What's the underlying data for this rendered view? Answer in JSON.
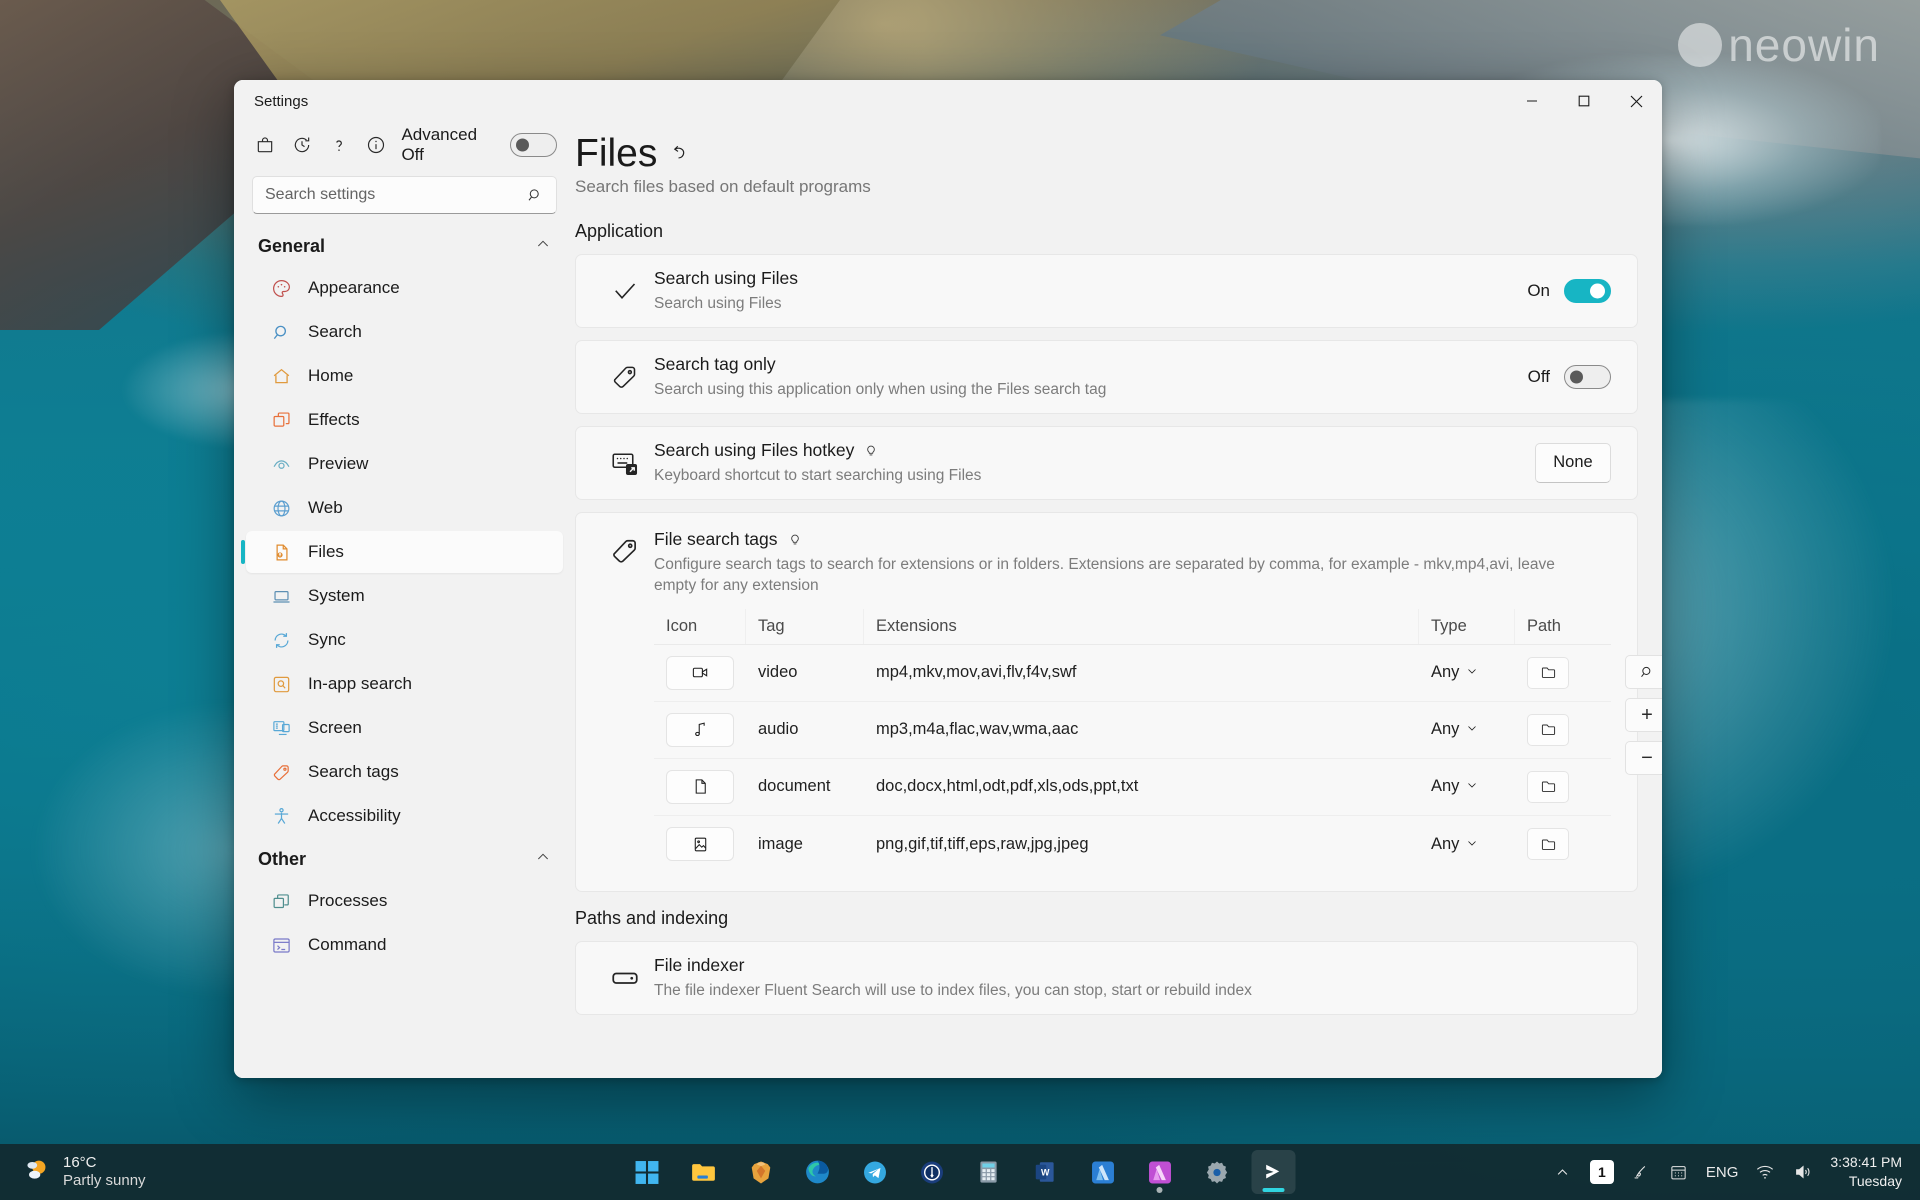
{
  "window": {
    "title": "Settings",
    "controls": {
      "minimize": "minimize-icon",
      "maximize": "maximize-icon",
      "close": "close-icon"
    }
  },
  "toolbar": {
    "icons": [
      "bag-icon",
      "history-icon",
      "help-icon",
      "info-icon"
    ],
    "advanced_label": "Advanced Off",
    "advanced_on": false
  },
  "search": {
    "placeholder": "Search settings",
    "value": ""
  },
  "sidebar": {
    "groups": [
      {
        "title": "General",
        "collapsed": false,
        "items": [
          {
            "label": "Appearance",
            "icon": "palette-icon",
            "active": false
          },
          {
            "label": "Search",
            "icon": "magnifier-icon",
            "active": false
          },
          {
            "label": "Home",
            "icon": "home-icon",
            "active": false
          },
          {
            "label": "Effects",
            "icon": "layers-icon",
            "active": false
          },
          {
            "label": "Preview",
            "icon": "eye-icon",
            "active": false
          },
          {
            "label": "Web",
            "icon": "globe-icon",
            "active": false
          },
          {
            "label": "Files",
            "icon": "file-arrow-icon",
            "active": true
          },
          {
            "label": "System",
            "icon": "laptop-icon",
            "active": false
          },
          {
            "label": "Sync",
            "icon": "sync-icon",
            "active": false
          },
          {
            "label": "In-app search",
            "icon": "boxed-search-icon",
            "active": false
          },
          {
            "label": "Screen",
            "icon": "monitor-icon",
            "active": false
          },
          {
            "label": "Search tags",
            "icon": "tag-icon",
            "active": false
          },
          {
            "label": "Accessibility",
            "icon": "accessibility-icon",
            "active": false
          }
        ]
      },
      {
        "title": "Other",
        "collapsed": false,
        "items": [
          {
            "label": "Processes",
            "icon": "windows-stack-icon",
            "active": false
          },
          {
            "label": "Command",
            "icon": "terminal-icon",
            "active": false
          }
        ]
      }
    ]
  },
  "page": {
    "title": "Files",
    "undo_icon": "undo-arrow-icon",
    "subtitle": "Search files based on default programs",
    "sections": [
      {
        "id": "application",
        "title": "Application"
      },
      {
        "id": "paths",
        "title": "Paths and indexing"
      }
    ]
  },
  "settings": {
    "search_using_files": {
      "icon": "check-icon",
      "title": "Search using Files",
      "desc": "Search using Files",
      "state_label": "On",
      "on": true
    },
    "search_tag_only": {
      "icon": "tag-icon",
      "title": "Search tag only",
      "desc": "Search using this application only when using the Files search tag",
      "state_label": "Off",
      "on": false
    },
    "hotkey": {
      "icon": "keyboard-shortcut-icon",
      "title": "Search using Files hotkey",
      "hint_icon": "bulb-icon",
      "desc": "Keyboard shortcut to start searching using Files",
      "button_label": "None"
    },
    "file_search_tags": {
      "icon": "tag-icon",
      "title": "File search tags",
      "hint_icon": "bulb-icon",
      "desc": "Configure search tags to search for extensions or in folders. Extensions are separated by comma, for example - mkv,mp4,avi, leave empty for any extension",
      "columns": [
        "Icon",
        "Tag",
        "Extensions",
        "Type",
        "Path"
      ],
      "rows": [
        {
          "icon": "video-camera-icon",
          "tag": "video",
          "extensions": "mp4,mkv,mov,avi,flv,f4v,swf",
          "type": "Any",
          "path_icon": "folder-icon"
        },
        {
          "icon": "music-note-icon",
          "tag": "audio",
          "extensions": "mp3,m4a,flac,wav,wma,aac",
          "type": "Any",
          "path_icon": "folder-icon"
        },
        {
          "icon": "document-icon",
          "tag": "document",
          "extensions": "doc,docx,html,odt,pdf,xls,ods,ppt,txt",
          "type": "Any",
          "path_icon": "folder-icon"
        },
        {
          "icon": "image-icon",
          "tag": "image",
          "extensions": "png,gif,tif,tiff,eps,raw,jpg,jpeg",
          "type": "Any",
          "path_icon": "folder-icon"
        }
      ],
      "side_buttons": [
        {
          "icon": "magnifier-icon",
          "label": ""
        },
        {
          "icon": "plus-icon",
          "label": "+"
        },
        {
          "icon": "minus-icon",
          "label": "−"
        }
      ]
    },
    "file_indexer": {
      "icon": "indexer-icon",
      "title": "File indexer",
      "desc": "The file indexer Fluent Search will use to index files, you can stop, start or rebuild index"
    }
  },
  "colors": {
    "accent": "#17b5c4",
    "window_bg": "#f2f2f2",
    "card_bg": "#f8f8f8",
    "text": "#1b1b1b",
    "muted": "#7c7c7c",
    "taskbar": "#122a2f"
  },
  "desktop": {
    "watermark": "neowin"
  },
  "taskbar": {
    "weather": {
      "temp": "16°C",
      "desc": "Partly sunny",
      "icon": "partly-sunny-icon"
    },
    "apps": [
      {
        "name": "start-button",
        "icon": "windows-logo-icon"
      },
      {
        "name": "file-explorer",
        "icon": "folder-icon"
      },
      {
        "name": "brave-browser",
        "icon": "brave-icon"
      },
      {
        "name": "microsoft-edge",
        "icon": "edge-icon"
      },
      {
        "name": "telegram",
        "icon": "telegram-icon"
      },
      {
        "name": "1password",
        "icon": "onepassword-icon"
      },
      {
        "name": "calculator",
        "icon": "calculator-icon"
      },
      {
        "name": "microsoft-word",
        "icon": "word-icon"
      },
      {
        "name": "affinity-designer",
        "icon": "affinity-designer-icon"
      },
      {
        "name": "affinity-photo",
        "icon": "affinity-photo-icon"
      },
      {
        "name": "settings",
        "icon": "gear-icon"
      },
      {
        "name": "fluent-search",
        "icon": "fluent-search-icon"
      }
    ],
    "tray": {
      "chevron": "chevron-up-icon",
      "badge": "1",
      "pen_icon": "pen-icon",
      "calendar_icon": "calendar-icon",
      "language": "ENG",
      "wifi_icon": "wifi-icon",
      "volume_icon": "volume-icon",
      "time": "3:38:41 PM",
      "day": "Tuesday"
    }
  }
}
